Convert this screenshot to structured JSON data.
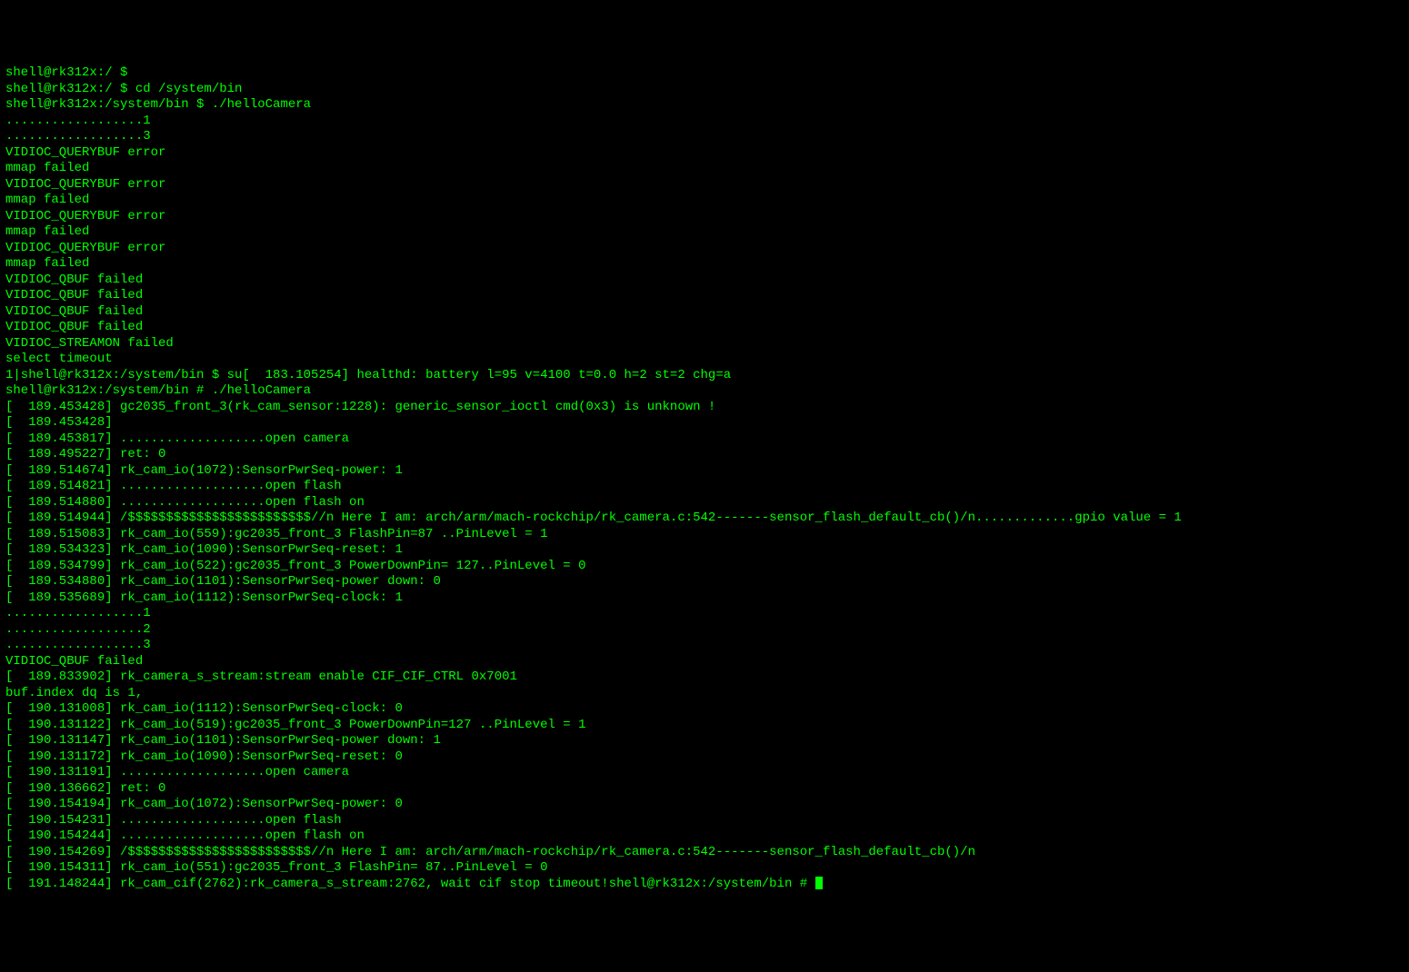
{
  "terminal": {
    "lines": [
      "shell@rk312x:/ $",
      "shell@rk312x:/ $ cd /system/bin",
      "shell@rk312x:/system/bin $ ./helloCamera",
      "..................1",
      "..................3",
      "VIDIOC_QUERYBUF error",
      "mmap failed",
      "VIDIOC_QUERYBUF error",
      "mmap failed",
      "VIDIOC_QUERYBUF error",
      "mmap failed",
      "VIDIOC_QUERYBUF error",
      "mmap failed",
      "VIDIOC_QBUF failed",
      "VIDIOC_QBUF failed",
      "VIDIOC_QBUF failed",
      "VIDIOC_QBUF failed",
      "VIDIOC_STREAMON failed",
      "select timeout",
      "1|shell@rk312x:/system/bin $ su[  183.105254] healthd: battery l=95 v=4100 t=0.0 h=2 st=2 chg=a",
      "",
      "shell@rk312x:/system/bin # ./helloCamera",
      "[  189.453428] gc2035_front_3(rk_cam_sensor:1228): generic_sensor_ioctl cmd(0x3) is unknown !",
      "[  189.453428]",
      "[  189.453817] ...................open camera",
      "[  189.495227] ret: 0",
      "[  189.514674] rk_cam_io(1072):SensorPwrSeq-power: 1",
      "[  189.514821] ...................open flash",
      "[  189.514880] ...................open flash on",
      "[  189.514944] /$$$$$$$$$$$$$$$$$$$$$$$$//n Here I am: arch/arm/mach-rockchip/rk_camera.c:542-------sensor_flash_default_cb()/n.............gpio value = 1",
      "[  189.515083] rk_cam_io(559):gc2035_front_3 FlashPin=87 ..PinLevel = 1",
      "[  189.534323] rk_cam_io(1090):SensorPwrSeq-reset: 1",
      "[  189.534799] rk_cam_io(522):gc2035_front_3 PowerDownPin= 127..PinLevel = 0",
      "[  189.534880] rk_cam_io(1101):SensorPwrSeq-power down: 0",
      "[  189.535689] rk_cam_io(1112):SensorPwrSeq-clock: 1",
      "..................1",
      "..................2",
      "..................3",
      "VIDIOC_QBUF failed",
      "[  189.833902] rk_camera_s_stream:stream enable CIF_CIF_CTRL 0x7001",
      "buf.index dq is 1,",
      "[  190.131008] rk_cam_io(1112):SensorPwrSeq-clock: 0",
      "[  190.131122] rk_cam_io(519):gc2035_front_3 PowerDownPin=127 ..PinLevel = 1",
      "[  190.131147] rk_cam_io(1101):SensorPwrSeq-power down: 1",
      "[  190.131172] rk_cam_io(1090):SensorPwrSeq-reset: 0",
      "[  190.131191] ...................open camera",
      "[  190.136662] ret: 0",
      "[  190.154194] rk_cam_io(1072):SensorPwrSeq-power: 0",
      "[  190.154231] ...................open flash",
      "[  190.154244] ...................open flash on",
      "[  190.154269] /$$$$$$$$$$$$$$$$$$$$$$$$//n Here I am: arch/arm/mach-rockchip/rk_camera.c:542-------sensor_flash_default_cb()/n",
      "[  190.154311] rk_cam_io(551):gc2035_front_3 FlashPin= 87..PinLevel = 0",
      "[  191.148244] rk_cam_cif(2762):rk_camera_s_stream:2762, wait cif stop timeout!shell@rk312x:/system/bin # "
    ]
  }
}
